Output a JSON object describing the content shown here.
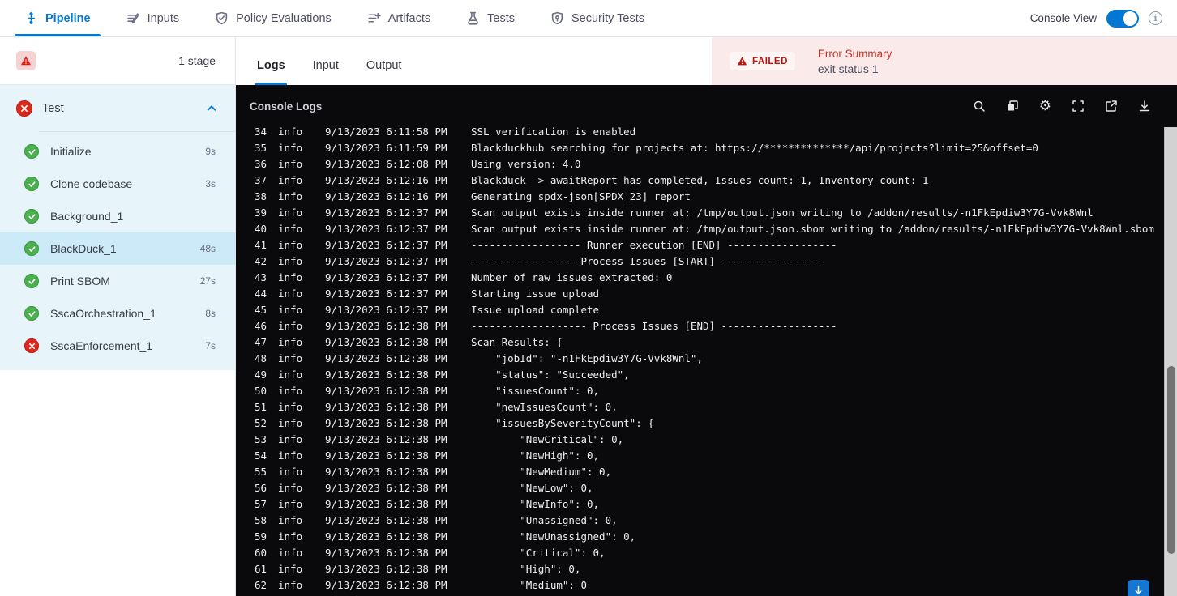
{
  "topnav": {
    "tabs": [
      {
        "label": "Pipeline",
        "icon": "pipeline-icon",
        "active": true
      },
      {
        "label": "Inputs",
        "icon": "inputs-icon",
        "active": false
      },
      {
        "label": "Policy Evaluations",
        "icon": "policy-shield-icon",
        "active": false
      },
      {
        "label": "Artifacts",
        "icon": "artifacts-icon",
        "active": false
      },
      {
        "label": "Tests",
        "icon": "flask-icon",
        "active": false
      },
      {
        "label": "Security Tests",
        "icon": "security-shield-icon",
        "active": false
      }
    ],
    "console_view_label": "Console View",
    "console_view_on": true
  },
  "sidebar": {
    "stage_count": "1 stage",
    "stage": {
      "name": "Test",
      "status": "failed"
    },
    "steps": [
      {
        "name": "Initialize",
        "duration": "9s",
        "status": "success",
        "selected": false
      },
      {
        "name": "Clone codebase",
        "duration": "3s",
        "status": "success",
        "selected": false
      },
      {
        "name": "Background_1",
        "duration": "",
        "status": "success",
        "selected": false
      },
      {
        "name": "BlackDuck_1",
        "duration": "48s",
        "status": "success",
        "selected": true
      },
      {
        "name": "Print SBOM",
        "duration": "27s",
        "status": "success",
        "selected": false
      },
      {
        "name": "SscaOrchestration_1",
        "duration": "8s",
        "status": "success",
        "selected": false
      },
      {
        "name": "SscaEnforcement_1",
        "duration": "7s",
        "status": "failed",
        "selected": false
      }
    ]
  },
  "main": {
    "tabs": [
      {
        "label": "Logs",
        "active": true
      },
      {
        "label": "Input",
        "active": false
      },
      {
        "label": "Output",
        "active": false
      }
    ],
    "error_summary": {
      "badge": "FAILED",
      "title": "Error Summary",
      "message": "exit status 1"
    },
    "console": {
      "title": "Console Logs",
      "action_icons": [
        "search-icon",
        "copy-icon",
        "settings-gear-icon",
        "fullscreen-icon",
        "open-in-new-icon",
        "download-icon"
      ],
      "logs": [
        {
          "n": 34,
          "level": "info",
          "ts": "9/13/2023 6:11:58 PM",
          "msg": "SSL verification is enabled"
        },
        {
          "n": 35,
          "level": "info",
          "ts": "9/13/2023 6:11:59 PM",
          "msg": "Blackduckhub searching for projects at: https://**************/api/projects?limit=25&offset=0"
        },
        {
          "n": 36,
          "level": "info",
          "ts": "9/13/2023 6:12:08 PM",
          "msg": "Using version: 4.0"
        },
        {
          "n": 37,
          "level": "info",
          "ts": "9/13/2023 6:12:16 PM",
          "msg": "Blackduck -> awaitReport has completed, Issues count: 1, Inventory count: 1"
        },
        {
          "n": 38,
          "level": "info",
          "ts": "9/13/2023 6:12:16 PM",
          "msg": "Generating spdx-json[SPDX_23] report"
        },
        {
          "n": 39,
          "level": "info",
          "ts": "9/13/2023 6:12:37 PM",
          "msg": "Scan output exists inside runner at: /tmp/output.json writing to /addon/results/-n1FkEpdiw3Y7G-Vvk8Wnl"
        },
        {
          "n": 40,
          "level": "info",
          "ts": "9/13/2023 6:12:37 PM",
          "msg": "Scan output exists inside runner at: /tmp/output.json.sbom writing to /addon/results/-n1FkEpdiw3Y7G-Vvk8Wnl.sbom"
        },
        {
          "n": 41,
          "level": "info",
          "ts": "9/13/2023 6:12:37 PM",
          "msg": "------------------ Runner execution [END] ------------------"
        },
        {
          "n": 42,
          "level": "info",
          "ts": "9/13/2023 6:12:37 PM",
          "msg": "----------------- Process Issues [START] -----------------"
        },
        {
          "n": 43,
          "level": "info",
          "ts": "9/13/2023 6:12:37 PM",
          "msg": "Number of raw issues extracted: 0"
        },
        {
          "n": 44,
          "level": "info",
          "ts": "9/13/2023 6:12:37 PM",
          "msg": "Starting issue upload"
        },
        {
          "n": 45,
          "level": "info",
          "ts": "9/13/2023 6:12:37 PM",
          "msg": "Issue upload complete"
        },
        {
          "n": 46,
          "level": "info",
          "ts": "9/13/2023 6:12:38 PM",
          "msg": "------------------- Process Issues [END] -------------------"
        },
        {
          "n": 47,
          "level": "info",
          "ts": "9/13/2023 6:12:38 PM",
          "msg": "Scan Results: {"
        },
        {
          "n": 48,
          "level": "info",
          "ts": "9/13/2023 6:12:38 PM",
          "msg": "    \"jobId\": \"-n1FkEpdiw3Y7G-Vvk8Wnl\","
        },
        {
          "n": 49,
          "level": "info",
          "ts": "9/13/2023 6:12:38 PM",
          "msg": "    \"status\": \"Succeeded\","
        },
        {
          "n": 50,
          "level": "info",
          "ts": "9/13/2023 6:12:38 PM",
          "msg": "    \"issuesCount\": 0,"
        },
        {
          "n": 51,
          "level": "info",
          "ts": "9/13/2023 6:12:38 PM",
          "msg": "    \"newIssuesCount\": 0,"
        },
        {
          "n": 52,
          "level": "info",
          "ts": "9/13/2023 6:12:38 PM",
          "msg": "    \"issuesBySeverityCount\": {"
        },
        {
          "n": 53,
          "level": "info",
          "ts": "9/13/2023 6:12:38 PM",
          "msg": "        \"NewCritical\": 0,"
        },
        {
          "n": 54,
          "level": "info",
          "ts": "9/13/2023 6:12:38 PM",
          "msg": "        \"NewHigh\": 0,"
        },
        {
          "n": 55,
          "level": "info",
          "ts": "9/13/2023 6:12:38 PM",
          "msg": "        \"NewMedium\": 0,"
        },
        {
          "n": 56,
          "level": "info",
          "ts": "9/13/2023 6:12:38 PM",
          "msg": "        \"NewLow\": 0,"
        },
        {
          "n": 57,
          "level": "info",
          "ts": "9/13/2023 6:12:38 PM",
          "msg": "        \"NewInfo\": 0,"
        },
        {
          "n": 58,
          "level": "info",
          "ts": "9/13/2023 6:12:38 PM",
          "msg": "        \"Unassigned\": 0,"
        },
        {
          "n": 59,
          "level": "info",
          "ts": "9/13/2023 6:12:38 PM",
          "msg": "        \"NewUnassigned\": 0,"
        },
        {
          "n": 60,
          "level": "info",
          "ts": "9/13/2023 6:12:38 PM",
          "msg": "        \"Critical\": 0,"
        },
        {
          "n": 61,
          "level": "info",
          "ts": "9/13/2023 6:12:38 PM",
          "msg": "        \"High\": 0,"
        },
        {
          "n": 62,
          "level": "info",
          "ts": "9/13/2023 6:12:38 PM",
          "msg": "        \"Medium\": 0"
        }
      ]
    }
  },
  "colors": {
    "accent_blue": "#0278d5",
    "success_green": "#4caf50",
    "danger_red": "#da291c",
    "error_bg_pink": "#fbeaea",
    "sidebar_stage_bg": "#e7f4fa",
    "selected_step_bg": "#cdeaf9",
    "console_bg": "#0a0a0c"
  }
}
